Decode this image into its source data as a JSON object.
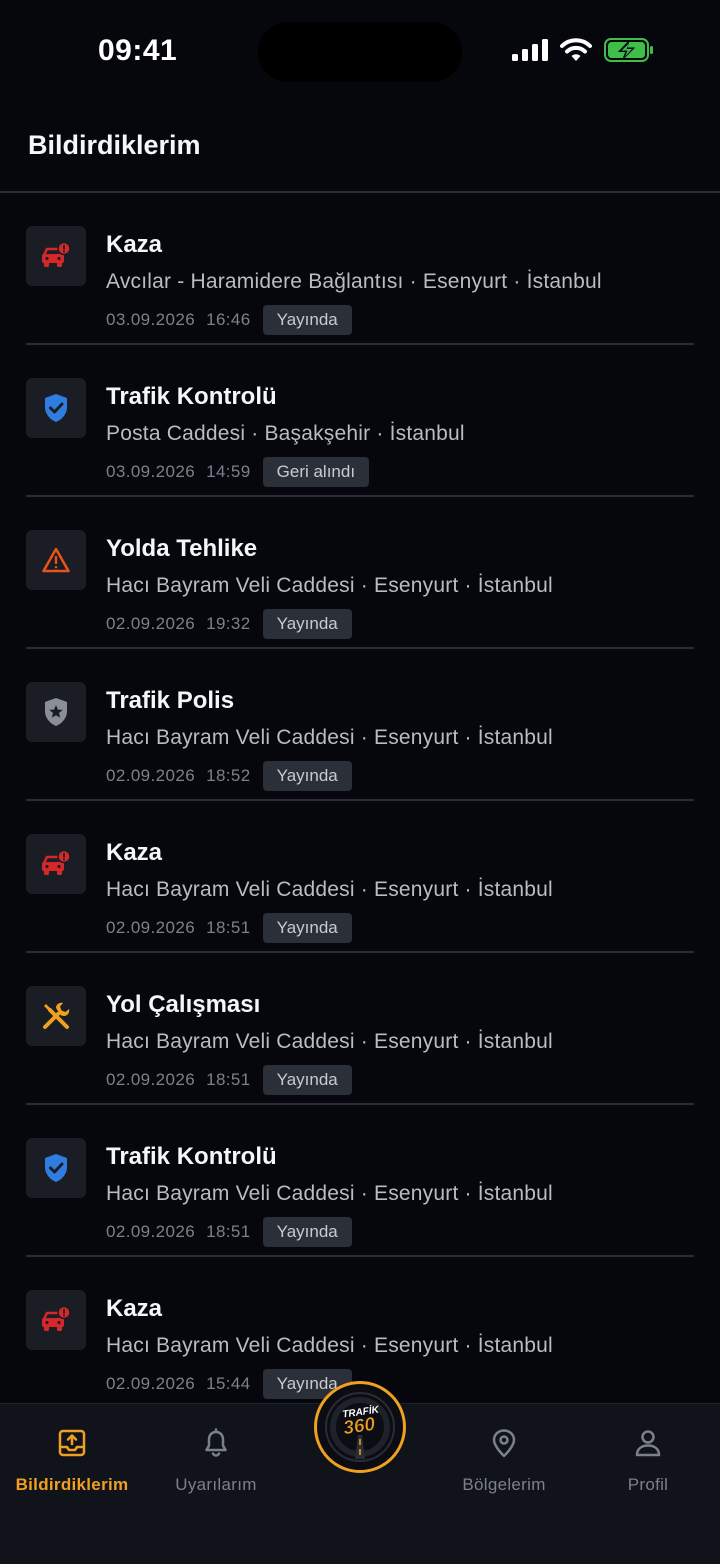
{
  "status": {
    "time": "09:41"
  },
  "header": {
    "title": "Bildirdiklerim"
  },
  "reports": [
    {
      "type": "accident",
      "title": "Kaza",
      "address": "Avcılar - Haramidere Bağlantısı · Esenyurt · İstanbul",
      "date": "03.09.2026",
      "time": "16:46",
      "status": "Yayında"
    },
    {
      "type": "control",
      "title": "Trafik Kontrolü",
      "address": "Posta Caddesi · Başakşehir · İstanbul",
      "date": "03.09.2026",
      "time": "14:59",
      "status": "Geri alındı"
    },
    {
      "type": "hazard",
      "title": "Yolda Tehlike",
      "address": "Hacı Bayram Veli Caddesi · Esenyurt · İstanbul",
      "date": "02.09.2026",
      "time": "19:32",
      "status": "Yayında"
    },
    {
      "type": "police",
      "title": "Trafik Polis",
      "address": "Hacı Bayram Veli Caddesi · Esenyurt · İstanbul",
      "date": "02.09.2026",
      "time": "18:52",
      "status": "Yayında"
    },
    {
      "type": "accident",
      "title": "Kaza",
      "address": "Hacı Bayram Veli Caddesi · Esenyurt · İstanbul",
      "date": "02.09.2026",
      "time": "18:51",
      "status": "Yayında"
    },
    {
      "type": "roadwork",
      "title": "Yol Çalışması",
      "address": "Hacı Bayram Veli Caddesi · Esenyurt · İstanbul",
      "date": "02.09.2026",
      "time": "18:51",
      "status": "Yayında"
    },
    {
      "type": "control",
      "title": "Trafik Kontrolü",
      "address": "Hacı Bayram Veli Caddesi · Esenyurt · İstanbul",
      "date": "02.09.2026",
      "time": "18:51",
      "status": "Yayında"
    },
    {
      "type": "accident",
      "title": "Kaza",
      "address": "Hacı Bayram Veli Caddesi · Esenyurt · İstanbul",
      "date": "02.09.2026",
      "time": "15:44",
      "status": "Yayında"
    }
  ],
  "tabs": [
    {
      "label": "Bildirdiklerim",
      "icon": "upload-tray-icon",
      "active": true
    },
    {
      "label": "Uyarılarım",
      "icon": "bell-icon",
      "active": false
    },
    {
      "label": "Bölgelerim",
      "icon": "map-pin-icon",
      "active": false
    },
    {
      "label": "Profil",
      "icon": "person-icon",
      "active": false
    }
  ],
  "center_button": {
    "logo_text": "TRAFİK",
    "logo_number": "360"
  },
  "colors": {
    "accent": "#f0a020",
    "accident": "#d6282b",
    "control": "#2f7de1",
    "hazard": "#e8541c",
    "roadwork": "#f0a020",
    "police": "#8a8e96"
  }
}
